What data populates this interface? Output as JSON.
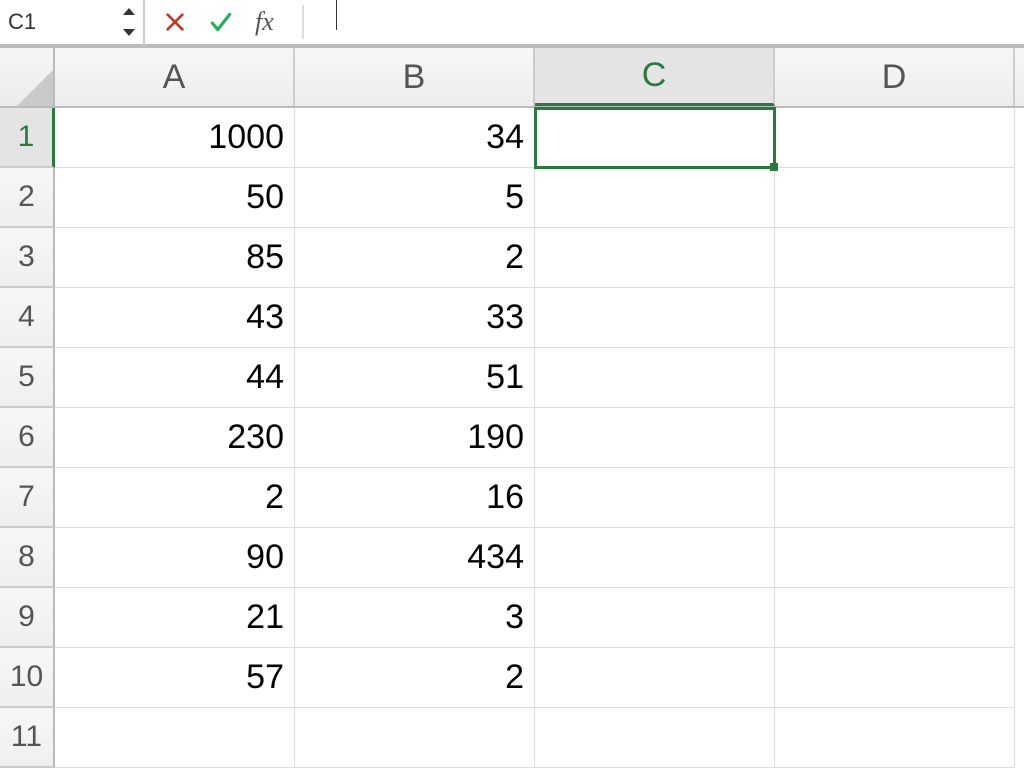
{
  "formula_bar": {
    "name_box": "C1",
    "fx_label": "fx",
    "formula_value": ""
  },
  "columns": [
    "A",
    "B",
    "C",
    "D"
  ],
  "active_column_index": 2,
  "active_row_index": 0,
  "rows": [
    {
      "num": "1",
      "cells": [
        "1000",
        "34",
        "",
        ""
      ],
      "selected_col": 2
    },
    {
      "num": "2",
      "cells": [
        "50",
        "5",
        "",
        ""
      ]
    },
    {
      "num": "3",
      "cells": [
        "85",
        "2",
        "",
        ""
      ]
    },
    {
      "num": "4",
      "cells": [
        "43",
        "33",
        "",
        ""
      ]
    },
    {
      "num": "5",
      "cells": [
        "44",
        "51",
        "",
        ""
      ]
    },
    {
      "num": "6",
      "cells": [
        "230",
        "190",
        "",
        ""
      ]
    },
    {
      "num": "7",
      "cells": [
        "2",
        "16",
        "",
        ""
      ]
    },
    {
      "num": "8",
      "cells": [
        "90",
        "434",
        "",
        ""
      ]
    },
    {
      "num": "9",
      "cells": [
        "21",
        "3",
        "",
        ""
      ]
    },
    {
      "num": "10",
      "cells": [
        "57",
        "2",
        "",
        ""
      ]
    },
    {
      "num": "11",
      "cells": [
        "",
        "",
        "",
        ""
      ]
    }
  ],
  "chart_data": {
    "type": "table",
    "columns": [
      "A",
      "B"
    ],
    "values": [
      [
        1000,
        34
      ],
      [
        50,
        5
      ],
      [
        85,
        2
      ],
      [
        43,
        33
      ],
      [
        44,
        51
      ],
      [
        230,
        190
      ],
      [
        2,
        16
      ],
      [
        90,
        434
      ],
      [
        21,
        3
      ],
      [
        57,
        2
      ]
    ]
  }
}
